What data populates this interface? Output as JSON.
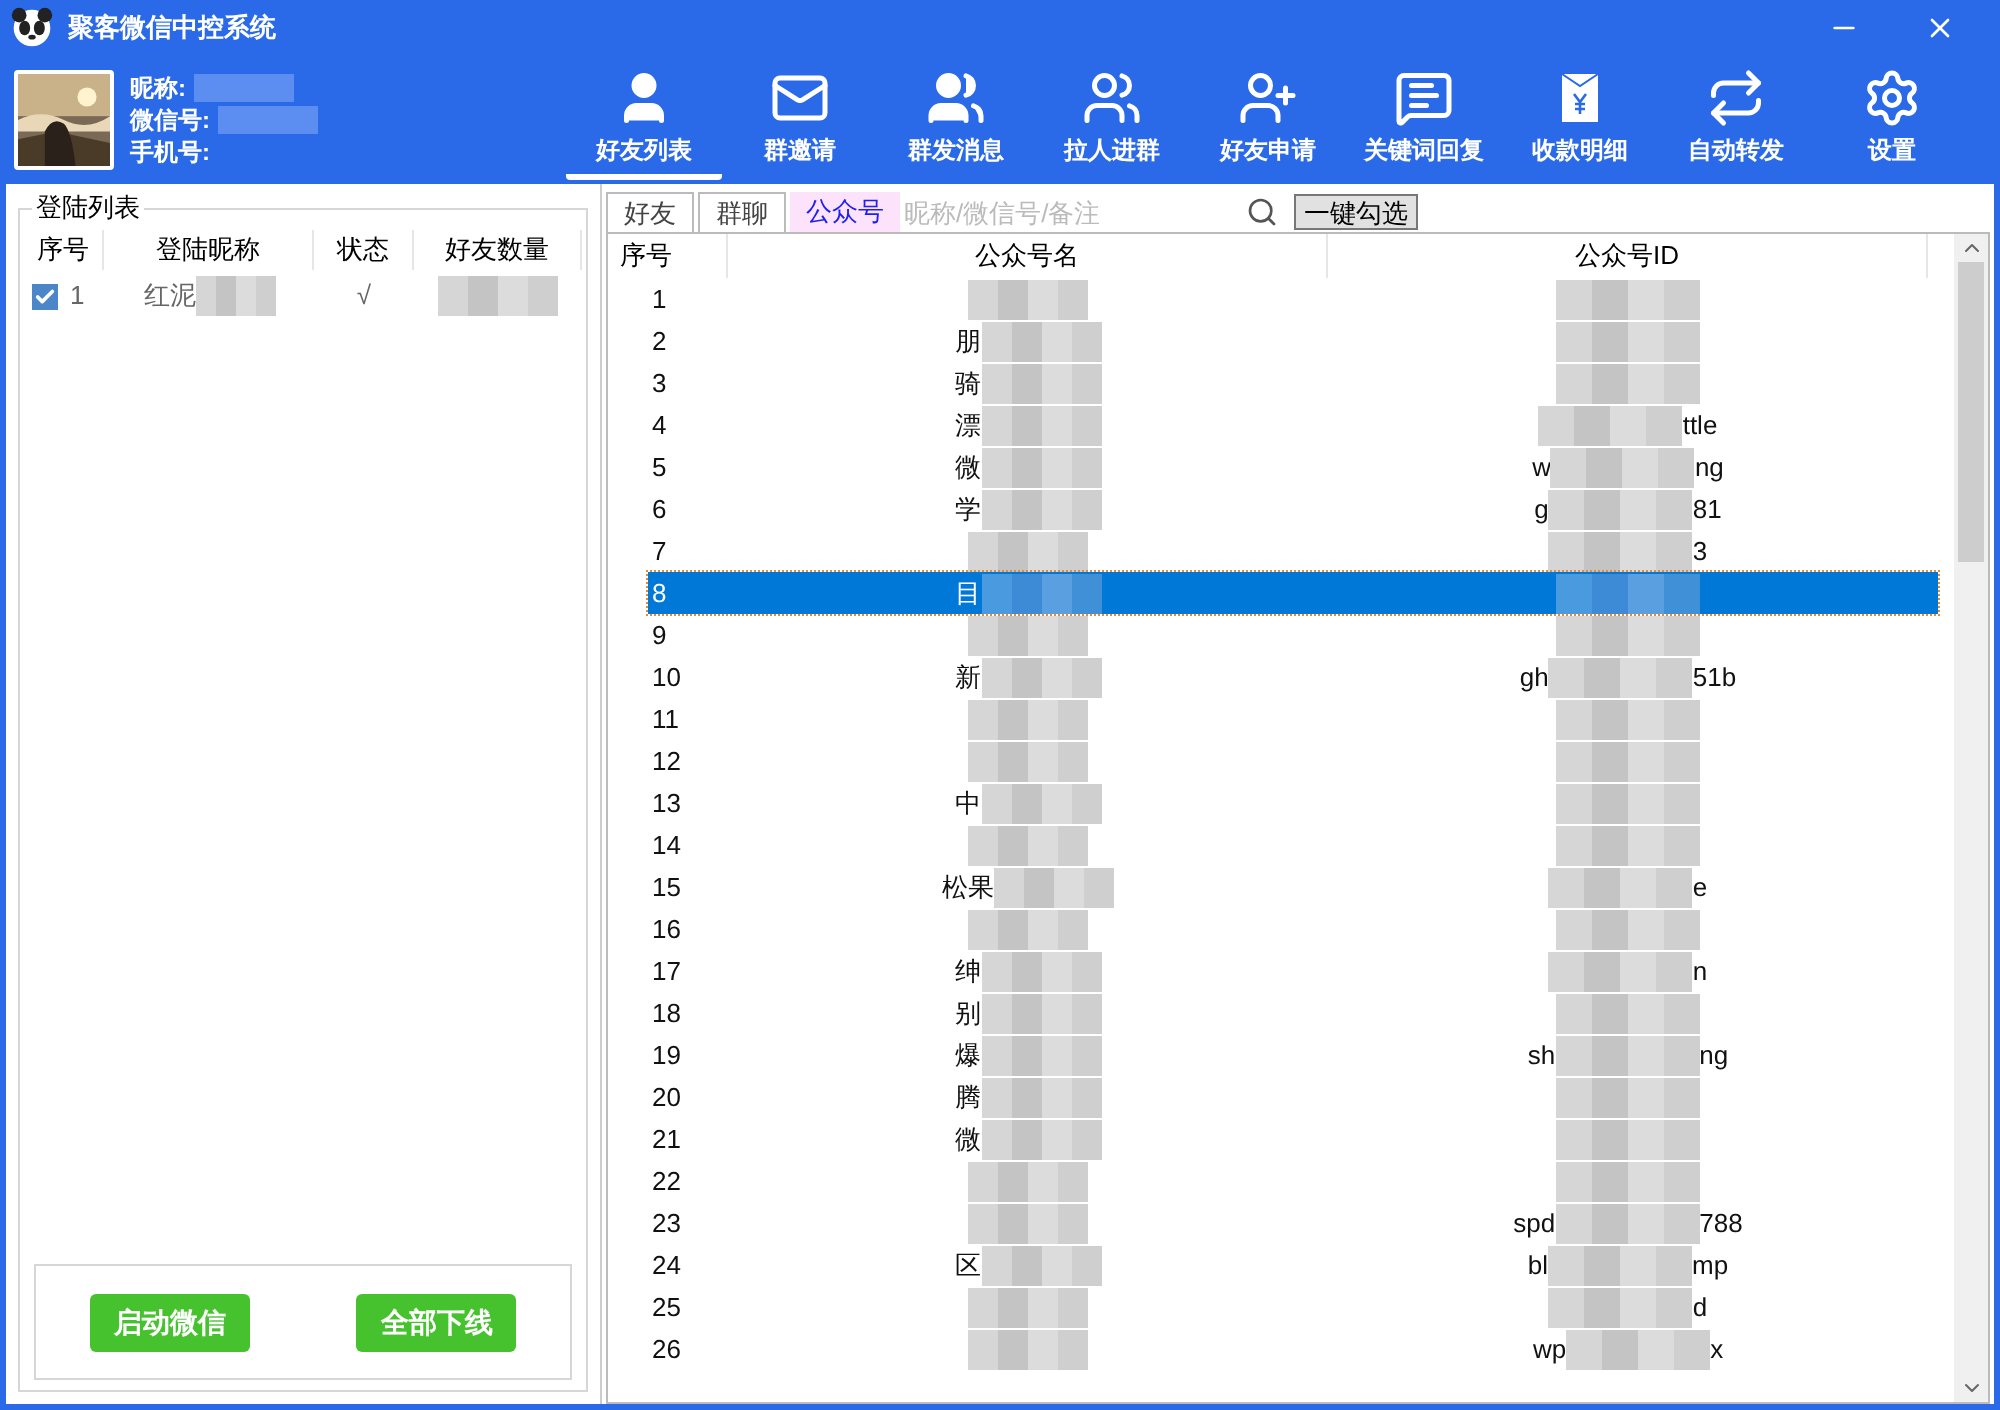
{
  "window": {
    "title": "聚客微信中控系统"
  },
  "profile": {
    "labels": [
      "昵称:",
      "微信号:",
      "手机号:"
    ]
  },
  "toolbar": [
    {
      "label": "好友列表",
      "kind": "friends",
      "selected": true
    },
    {
      "label": "群邀请",
      "kind": "mail",
      "selected": false
    },
    {
      "label": "群发消息",
      "kind": "broadcast",
      "selected": false
    },
    {
      "label": "拉人进群",
      "kind": "pull",
      "selected": false
    },
    {
      "label": "好友申请",
      "kind": "add",
      "selected": false
    },
    {
      "label": "关键词回复",
      "kind": "chat",
      "selected": false
    },
    {
      "label": "收款明细",
      "kind": "money",
      "selected": false
    },
    {
      "label": "自动转发",
      "kind": "repeat",
      "selected": false
    },
    {
      "label": "设置",
      "kind": "gear",
      "selected": false
    }
  ],
  "login_list": {
    "title": "登陆列表",
    "columns": [
      "序号",
      "登陆昵称",
      "状态",
      "好友数量"
    ],
    "rows": [
      {
        "index": "1",
        "nickname": "红泥",
        "status": "√",
        "checked": true
      }
    ],
    "buttons": [
      "启动微信",
      "全部下线"
    ]
  },
  "tabs": [
    {
      "label": "好友",
      "selected": false
    },
    {
      "label": "群聊",
      "selected": false
    },
    {
      "label": "公众号",
      "selected": true
    }
  ],
  "search": {
    "placeholder": "昵称/微信号/备注"
  },
  "select_all_button": "一键勾选",
  "table": {
    "columns": [
      "序号",
      "公众号名",
      "公众号ID"
    ],
    "rows": [
      {
        "index": "1",
        "name": "",
        "id_start": "",
        "id_end": "",
        "selected": false
      },
      {
        "index": "2",
        "name": "朋",
        "id_start": "",
        "id_end": "",
        "selected": false
      },
      {
        "index": "3",
        "name": "骑",
        "id_start": "",
        "id_end": "",
        "selected": false
      },
      {
        "index": "4",
        "name": "漂",
        "id_start": "",
        "id_end": "ttle",
        "selected": false
      },
      {
        "index": "5",
        "name": "微",
        "id_start": "w",
        "id_end": "ng",
        "selected": false
      },
      {
        "index": "6",
        "name": "学",
        "id_start": "g",
        "id_end": "81",
        "selected": false
      },
      {
        "index": "7",
        "name": "",
        "id_start": "",
        "id_end": "3",
        "selected": false
      },
      {
        "index": "8",
        "name": "目",
        "id_start": "",
        "id_end": "",
        "selected": true
      },
      {
        "index": "9",
        "name": "",
        "id_start": "",
        "id_end": "",
        "selected": false
      },
      {
        "index": "10",
        "name": "新",
        "id_start": "gh",
        "id_end": "51b",
        "selected": false
      },
      {
        "index": "11",
        "name": "",
        "id_start": "",
        "id_end": "",
        "selected": false
      },
      {
        "index": "12",
        "name": "",
        "id_start": "",
        "id_end": "",
        "selected": false
      },
      {
        "index": "13",
        "name": "中",
        "id_start": "",
        "id_end": "",
        "selected": false
      },
      {
        "index": "14",
        "name": "",
        "id_start": "",
        "id_end": "",
        "selected": false
      },
      {
        "index": "15",
        "name": "松果",
        "id_start": "",
        "id_end": "e",
        "selected": false
      },
      {
        "index": "16",
        "name": "",
        "id_start": "",
        "id_end": "",
        "selected": false
      },
      {
        "index": "17",
        "name": "绅",
        "id_start": "",
        "id_end": "n",
        "selected": false
      },
      {
        "index": "18",
        "name": "别",
        "id_start": "",
        "id_end": "",
        "selected": false
      },
      {
        "index": "19",
        "name": "爆",
        "id_start": "sh",
        "id_end": "ng",
        "selected": false
      },
      {
        "index": "20",
        "name": "腾",
        "id_start": "",
        "id_end": "",
        "selected": false
      },
      {
        "index": "21",
        "name": "微",
        "id_start": "",
        "id_end": "",
        "selected": false
      },
      {
        "index": "22",
        "name": "",
        "id_start": "",
        "id_end": "",
        "selected": false
      },
      {
        "index": "23",
        "name": "",
        "id_start": "spd",
        "id_end": "788",
        "selected": false
      },
      {
        "index": "24",
        "name": "区",
        "id_start": "bl",
        "id_end": "mp",
        "selected": false
      },
      {
        "index": "25",
        "name": "",
        "id_start": "",
        "id_end": "d",
        "selected": false
      },
      {
        "index": "26",
        "name": "",
        "id_start": "wp",
        "id_end": "x",
        "selected": false
      }
    ]
  }
}
